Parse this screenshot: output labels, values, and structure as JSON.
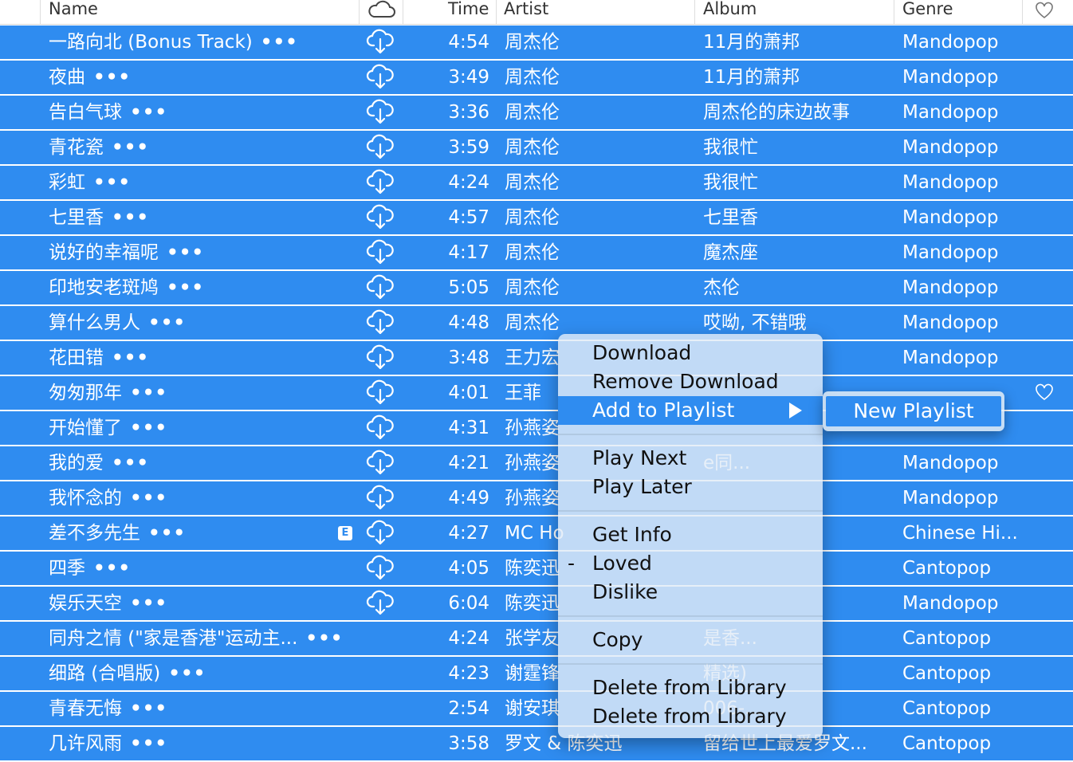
{
  "header": {
    "name": "Name",
    "time": "Time",
    "artist": "Artist",
    "album": "Album",
    "genre": "Genre",
    "cloud_icon": "cloud-icon",
    "heart_icon": "heart-outline-icon"
  },
  "colors": {
    "selection": "#2f8cf0",
    "menu_bg": "#e2ecf6"
  },
  "rows": [
    {
      "name": "一路向北 (Bonus Track)",
      "time": "4:54",
      "artist": "周杰伦",
      "album": "11月的萧邦",
      "genre": "Mandopop",
      "cloud": true,
      "explicit": false
    },
    {
      "name": "夜曲",
      "time": "3:49",
      "artist": "周杰伦",
      "album": "11月的萧邦",
      "genre": "Mandopop",
      "cloud": true,
      "explicit": false
    },
    {
      "name": "告白气球",
      "time": "3:36",
      "artist": "周杰伦",
      "album": "周杰伦的床边故事",
      "genre": "Mandopop",
      "cloud": true,
      "explicit": false
    },
    {
      "name": "青花瓷",
      "time": "3:59",
      "artist": "周杰伦",
      "album": "我很忙",
      "genre": "Mandopop",
      "cloud": true,
      "explicit": false
    },
    {
      "name": "彩虹",
      "time": "4:24",
      "artist": "周杰伦",
      "album": "我很忙",
      "genre": "Mandopop",
      "cloud": true,
      "explicit": false
    },
    {
      "name": "七里香",
      "time": "4:57",
      "artist": "周杰伦",
      "album": "七里香",
      "genre": "Mandopop",
      "cloud": true,
      "explicit": false
    },
    {
      "name": "说好的幸福呢",
      "time": "4:17",
      "artist": "周杰伦",
      "album": "魔杰座",
      "genre": "Mandopop",
      "cloud": true,
      "explicit": false
    },
    {
      "name": "印地安老斑鸠",
      "time": "5:05",
      "artist": "周杰伦",
      "album": "杰伦",
      "genre": "Mandopop",
      "cloud": true,
      "explicit": false
    },
    {
      "name": "算什么男人",
      "time": "4:48",
      "artist": "周杰伦",
      "album": "哎呦, 不错哦",
      "genre": "Mandopop",
      "cloud": true,
      "explicit": false
    },
    {
      "name": "花田错",
      "time": "3:48",
      "artist": "王力宏",
      "album": "",
      "genre": "Mandopop",
      "cloud": true,
      "explicit": false
    },
    {
      "name": "匆匆那年",
      "time": "4:01",
      "artist": "王菲",
      "album": "",
      "genre": "",
      "cloud": true,
      "explicit": false,
      "heart": true
    },
    {
      "name": "开始懂了",
      "time": "4:31",
      "artist": "孙燕姿",
      "album": "",
      "genre": "",
      "cloud": true,
      "explicit": false
    },
    {
      "name": "我的爱",
      "time": "4:21",
      "artist": "孙燕姿",
      "album": "e同...",
      "genre": "Mandopop",
      "cloud": true,
      "explicit": false
    },
    {
      "name": "我怀念的",
      "time": "4:49",
      "artist": "孙燕姿",
      "album": "",
      "genre": "Mandopop",
      "cloud": true,
      "explicit": false
    },
    {
      "name": "差不多先生",
      "time": "4:27",
      "artist": "MC Ho",
      "album": "",
      "genre": "Chinese Hi...",
      "cloud": true,
      "explicit": true
    },
    {
      "name": "四季",
      "time": "4:05",
      "artist": "陈奕迅",
      "album": "",
      "genre": "Cantopop",
      "cloud": true,
      "explicit": false
    },
    {
      "name": "娱乐天空",
      "time": "6:04",
      "artist": "陈奕迅",
      "album": "",
      "genre": "Mandopop",
      "cloud": true,
      "explicit": false
    },
    {
      "name": "同舟之情 (\"家是香港\"运动主...",
      "time": "4:24",
      "artist": "张学友",
      "album": "是香...",
      "genre": "Cantopop",
      "cloud": false,
      "explicit": false
    },
    {
      "name": "细路 (合唱版)",
      "time": "4:23",
      "artist": "谢霆锋",
      "album": "精选)",
      "genre": "Cantopop",
      "cloud": false,
      "explicit": false
    },
    {
      "name": "青春无悔",
      "time": "2:54",
      "artist": "谢安琪",
      "album": "006-...",
      "genre": "Cantopop",
      "cloud": false,
      "explicit": false
    },
    {
      "name": "几许风雨",
      "time": "3:58",
      "artist": "罗文 & 陈奕迅",
      "album": "留给世上最爱罗文...",
      "genre": "Cantopop",
      "cloud": false,
      "explicit": false
    }
  ],
  "row_more": "•••",
  "explicit_badge": "E",
  "context_menu": {
    "download": "Download",
    "remove_download": "Remove Download",
    "add_to_playlist": "Add to Playlist",
    "play_next": "Play Next",
    "play_later": "Play Later",
    "get_info": "Get Info",
    "loved_mark": "-",
    "loved": "Loved",
    "dislike": "Dislike",
    "copy": "Copy",
    "delete_1": "Delete from Library",
    "delete_2": "Delete from Library"
  },
  "submenu": {
    "new_playlist": "New Playlist"
  }
}
